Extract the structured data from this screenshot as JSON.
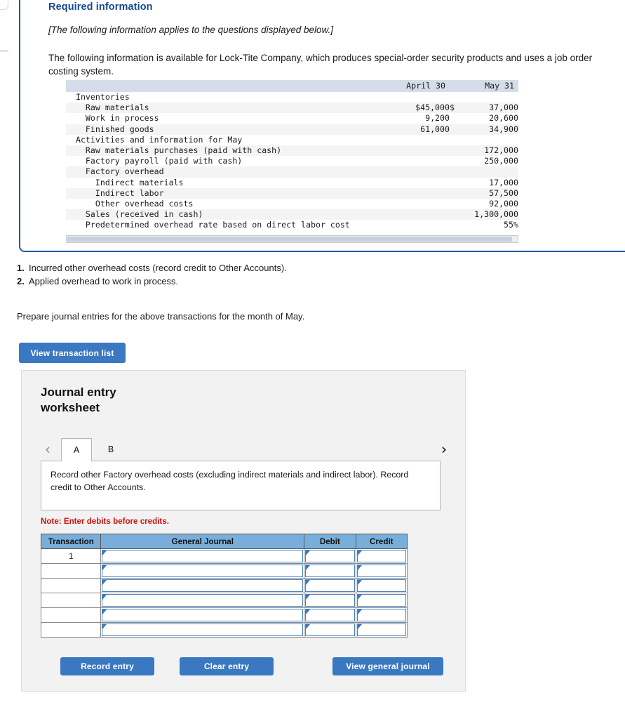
{
  "required_info": {
    "title": "Required information",
    "applies_note": "[The following information applies to the questions displayed below.]",
    "intro": "The following information is available for Lock-Tite Company, which produces special-order security products and uses a job order costing system."
  },
  "data_table": {
    "headers": [
      "",
      "April 30",
      "May 31"
    ],
    "rows": [
      {
        "label": "Inventories",
        "indent": 1,
        "april": "",
        "may": "",
        "dollar": "",
        "zebra": false
      },
      {
        "label": "Raw materials",
        "indent": 2,
        "april": "$45,000",
        "may": "37,000",
        "dollar": "$",
        "zebra": true
      },
      {
        "label": "Work in process",
        "indent": 2,
        "april": "9,200",
        "may": "20,600",
        "dollar": "",
        "zebra": false
      },
      {
        "label": "Finished goods",
        "indent": 2,
        "april": "61,000",
        "may": "34,900",
        "dollar": "",
        "zebra": true
      },
      {
        "label": "Activities and information for May",
        "indent": 1,
        "april": "",
        "may": "",
        "dollar": "",
        "zebra": false
      },
      {
        "label": "Raw materials purchases (paid with cash)",
        "indent": 2,
        "april": "",
        "may": "172,000",
        "dollar": "",
        "zebra": true
      },
      {
        "label": "Factory payroll (paid with cash)",
        "indent": 2,
        "april": "",
        "may": "250,000",
        "dollar": "",
        "zebra": false
      },
      {
        "label": "Factory overhead",
        "indent": 2,
        "april": "",
        "may": "",
        "dollar": "",
        "zebra": true
      },
      {
        "label": "Indirect materials",
        "indent": 3,
        "april": "",
        "may": "17,000",
        "dollar": "",
        "zebra": false
      },
      {
        "label": "Indirect labor",
        "indent": 3,
        "april": "",
        "may": "57,500",
        "dollar": "",
        "zebra": true
      },
      {
        "label": "Other overhead costs",
        "indent": 3,
        "april": "",
        "may": "92,000",
        "dollar": "",
        "zebra": false
      },
      {
        "label": "Sales (received in cash)",
        "indent": 2,
        "april": "",
        "may": "1,300,000",
        "dollar": "",
        "zebra": true
      },
      {
        "label": "Predetermined overhead rate based on direct labor cost",
        "indent": 2,
        "april": "",
        "may": "55%",
        "dollar": "",
        "zebra": false
      }
    ]
  },
  "transactions": [
    {
      "num": "1.",
      "text": "Incurred other overhead costs (record credit to Other Accounts)."
    },
    {
      "num": "2.",
      "text": "Applied overhead to work in process."
    }
  ],
  "prepare_text": "Prepare journal entries for the above transactions for the month of May.",
  "view_transaction_list_label": "View transaction list",
  "worksheet": {
    "title": "Journal entry worksheet",
    "prev_arrow": "‹",
    "next_arrow": "›",
    "tabs": [
      {
        "label": "A",
        "active": true
      },
      {
        "label": "B",
        "active": false
      }
    ],
    "panel_text": "Record other Factory overhead costs (excluding indirect materials and indirect labor). Record credit to Other Accounts.",
    "note": "Note: Enter debits before credits.",
    "journal_table": {
      "headers": [
        "Transaction",
        "General Journal",
        "Debit",
        "Credit"
      ],
      "rows": [
        {
          "transaction": "1"
        },
        {
          "transaction": ""
        },
        {
          "transaction": ""
        },
        {
          "transaction": ""
        },
        {
          "transaction": ""
        },
        {
          "transaction": ""
        }
      ]
    },
    "buttons": {
      "record": "Record entry",
      "clear": "Clear entry",
      "journal": "View general journal"
    }
  },
  "colors": {
    "accent_blue": "#3b78c2",
    "card_border_blue": "#2a5899",
    "title_blue": "#1a4a8d",
    "note_red": "#cc1111",
    "table_header_blue": "#7aaeda",
    "data_header_bg": "#d6dce9"
  }
}
